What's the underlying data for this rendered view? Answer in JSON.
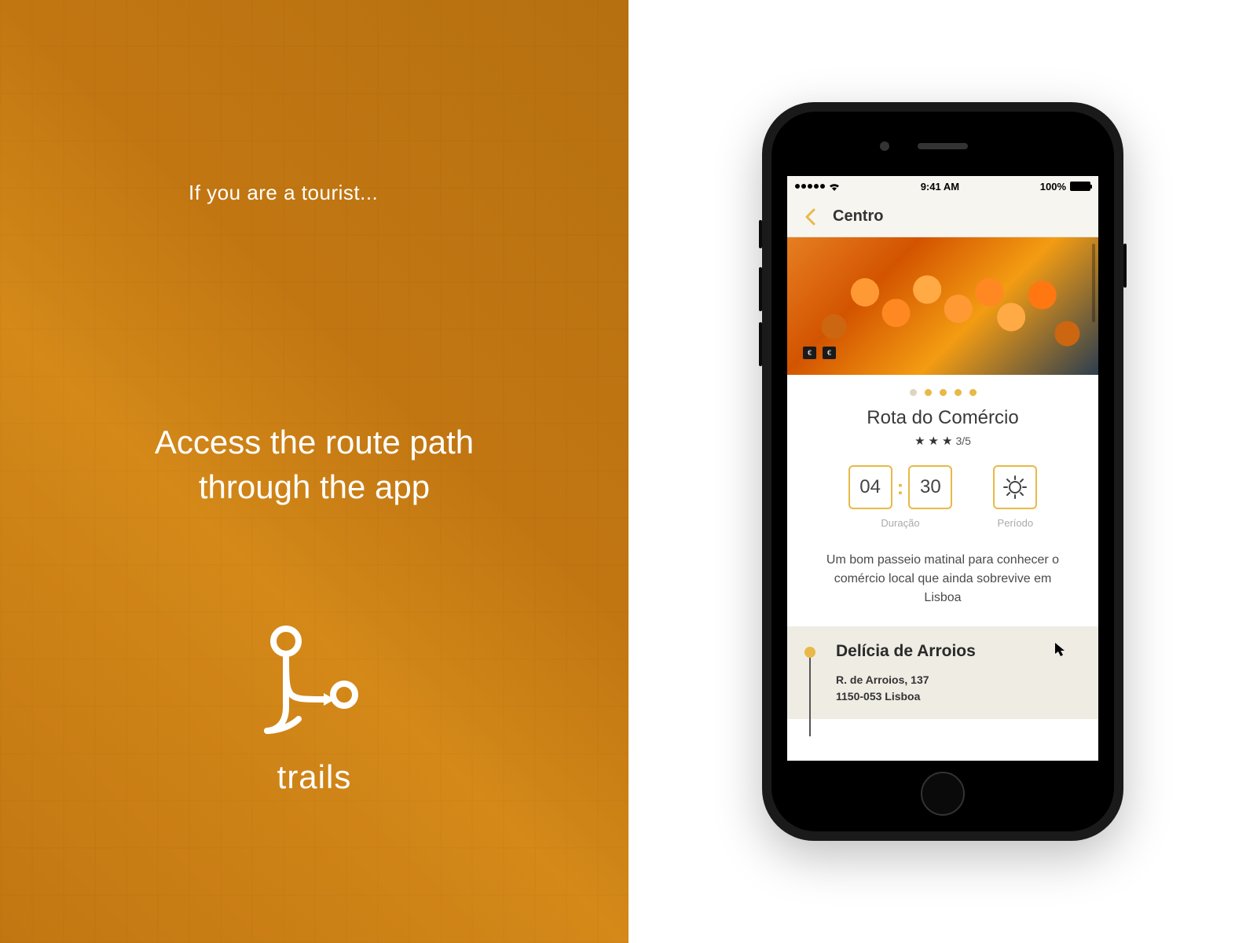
{
  "left": {
    "tourist_line": "If you are a tourist...",
    "headline": "Access the route path through the app",
    "logo_text": "trails"
  },
  "phone": {
    "status": {
      "time": "9:41 AM",
      "battery": "100%"
    },
    "nav": {
      "back_title": "Centro"
    },
    "carousel": {
      "dots_total": 5,
      "dots_active_start": 1
    },
    "route": {
      "title": "Rota do Comércio",
      "rating": {
        "filled": 3,
        "total": 5,
        "text": "3/5"
      },
      "duration": {
        "hours": "04",
        "minutes": "30",
        "label": "Duração",
        "separator": ":"
      },
      "period": {
        "label": "Período",
        "icon": "sun-icon"
      },
      "description": "Um bom passeio matinal para conhecer o comércio local que ainda sobrevive em Lisboa"
    },
    "poi": {
      "name": "Delícia de Arroios",
      "address_line1": "R. de Arroios, 137",
      "address_line2": "1150-053 Lisboa"
    }
  },
  "colors": {
    "accent": "#e8b948",
    "text_dark": "#333333"
  }
}
